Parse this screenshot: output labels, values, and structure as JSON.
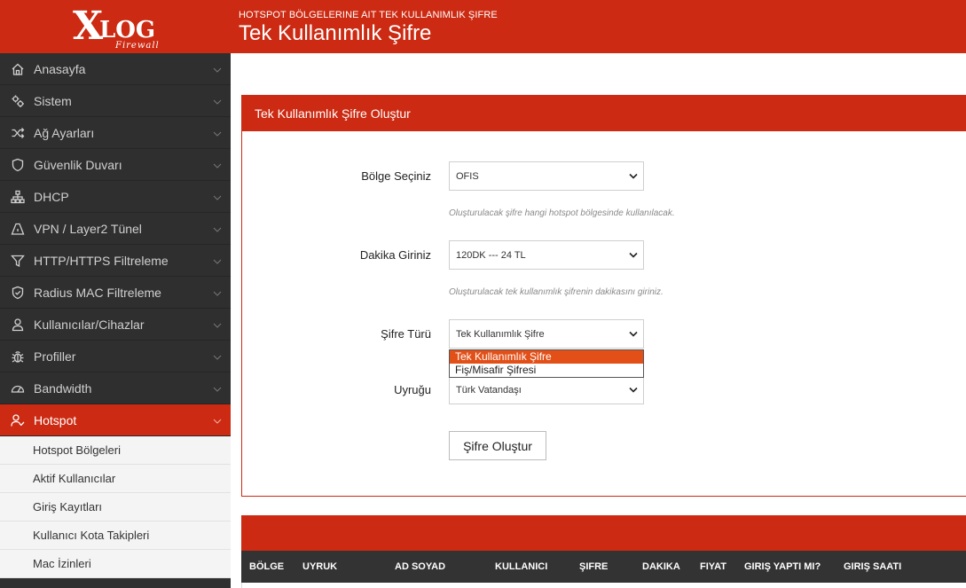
{
  "brand": {
    "logo_x": "X",
    "logo_rest": "LOG",
    "logo_sub": "Firewall",
    "accent": "#cc2a12",
    "sidebar_bg": "#2f2f2f"
  },
  "header": {
    "supertitle": "HOTSPOT BÖLGELERINE AIT TEK KULLANIMLIK ŞIFRE",
    "title": "Tek Kullanımlık Şifre"
  },
  "sidebar": {
    "items": [
      {
        "label": "Anasayfa",
        "icon": "home-icon"
      },
      {
        "label": "Sistem",
        "icon": "gears-icon"
      },
      {
        "label": "Ağ Ayarları",
        "icon": "shuffle-icon"
      },
      {
        "label": "Güvenlik Duvarı",
        "icon": "shield-icon"
      },
      {
        "label": "DHCP",
        "icon": "sitemap-icon"
      },
      {
        "label": "VPN / Layer2 Tünel",
        "icon": "tunnel-icon"
      },
      {
        "label": "HTTP/HTTPS Filtreleme",
        "icon": "filter-icon"
      },
      {
        "label": "Radius MAC Filtreleme",
        "icon": "shield-check-icon"
      },
      {
        "label": "Kullanıcılar/Cihazlar",
        "icon": "user-icon"
      },
      {
        "label": "Profiller",
        "icon": "bug-icon"
      },
      {
        "label": "Bandwidth",
        "icon": "gauge-icon"
      },
      {
        "label": "Hotspot",
        "icon": "user-check-icon"
      }
    ],
    "submenu": [
      "Hotspot Bölgeleri",
      "Aktif Kullanıcılar",
      "Giriş Kayıtları",
      "Kullanıcı Kota Takipleri",
      "Mac İzinleri"
    ]
  },
  "form": {
    "card_title": "Tek Kullanımlık Şifre Oluştur",
    "region": {
      "label": "Bölge Seçiniz",
      "value": "OFIS",
      "help": "Oluşturulacak şifre hangi hotspot bölgesinde kullanılacak."
    },
    "minutes": {
      "label": "Dakika Giriniz",
      "value": "120DK --- 24 TL",
      "help": "Oluşturulacak tek kullanımlık şifrenin dakikasını giriniz."
    },
    "type": {
      "label": "Şifre Türü",
      "value": "Tek Kullanımlık Şifre",
      "options": [
        "Tek Kullanımlık Şifre",
        "Fiş/Misafir Şifresi"
      ]
    },
    "nationality": {
      "label": "Uyruğu",
      "value": "Türk Vatandaşı"
    },
    "submit_label": "Şifre Oluştur"
  },
  "table": {
    "columns": [
      "BÖLGE",
      "UYRUK",
      "AD SOYAD",
      "KULLANICI",
      "ŞIFRE",
      "DAKIKA",
      "FIYAT",
      "GIRIŞ YAPTI MI?",
      "GIRIŞ SAATI"
    ]
  }
}
